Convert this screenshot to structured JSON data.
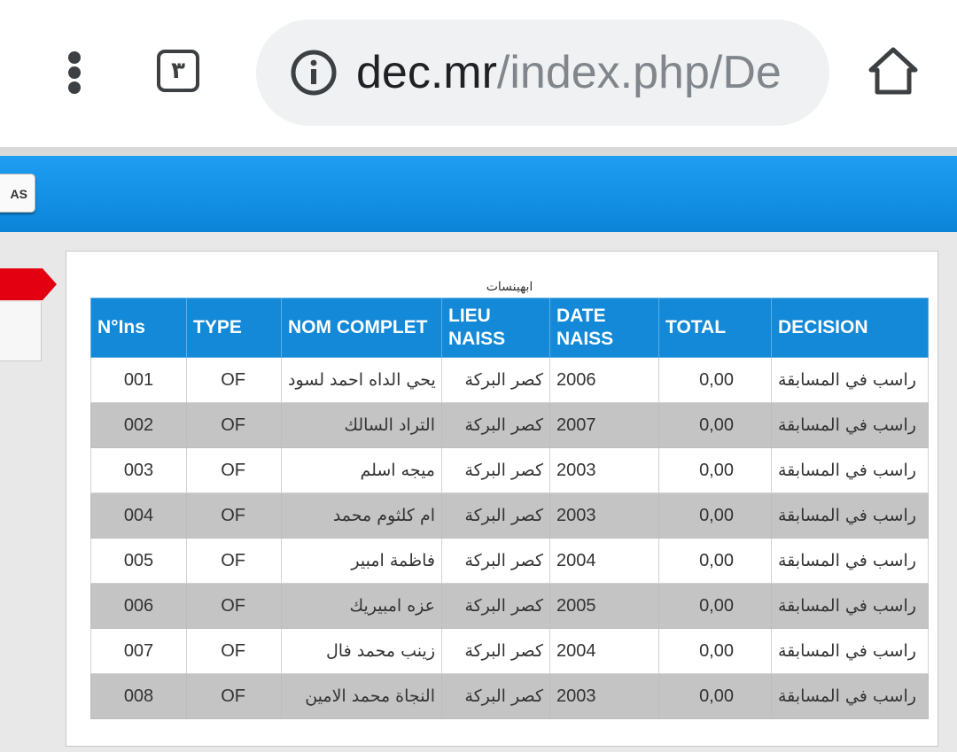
{
  "browser": {
    "tab_count": "٣",
    "url_domain": "dec.mr",
    "url_path": "/index.php/De",
    "icons": [
      "more-vert-icon",
      "tabs-icon",
      "info-icon",
      "home-icon"
    ]
  },
  "header": {
    "button_label": "AS",
    "color": "#1389d7"
  },
  "sidebar": {
    "active_color": "#e30010"
  },
  "table": {
    "caption": "ابهينسات",
    "columns": [
      "N°Ins",
      "TYPE",
      "NOM COMPLET",
      "LIEU NAISS",
      "DATE NAISS",
      "TOTAL",
      "DECISION"
    ],
    "rows": [
      {
        "num": "001",
        "type": "OF",
        "name": "يحي الداه احمد لسود",
        "place": "كصر البركة",
        "year": "2006",
        "total": "0,00",
        "decision": "راسب في المسابقة"
      },
      {
        "num": "002",
        "type": "OF",
        "name": "التراد السالك",
        "place": "كصر البركة",
        "year": "2007",
        "total": "0,00",
        "decision": "راسب في المسابقة"
      },
      {
        "num": "003",
        "type": "OF",
        "name": "ميجه اسلم",
        "place": "كصر البركة",
        "year": "2003",
        "total": "0,00",
        "decision": "راسب في المسابقة"
      },
      {
        "num": "004",
        "type": "OF",
        "name": "ام كلثوم محمد",
        "place": "كصر البركة",
        "year": "2003",
        "total": "0,00",
        "decision": "راسب في المسابقة"
      },
      {
        "num": "005",
        "type": "OF",
        "name": "فاظمة امبير",
        "place": "كصر البركة",
        "year": "2004",
        "total": "0,00",
        "decision": "راسب في المسابقة"
      },
      {
        "num": "006",
        "type": "OF",
        "name": "عزه امبيريك",
        "place": "كصر البركة",
        "year": "2005",
        "total": "0,00",
        "decision": "راسب في المسابقة"
      },
      {
        "num": "007",
        "type": "OF",
        "name": "زينب محمد فال",
        "place": "كصر البركة",
        "year": "2004",
        "total": "0,00",
        "decision": "راسب في المسابقة"
      },
      {
        "num": "008",
        "type": "OF",
        "name": "النجاة محمد الامين",
        "place": "كصر البركة",
        "year": "2003",
        "total": "0,00",
        "decision": "راسب في المسابقة"
      }
    ]
  }
}
